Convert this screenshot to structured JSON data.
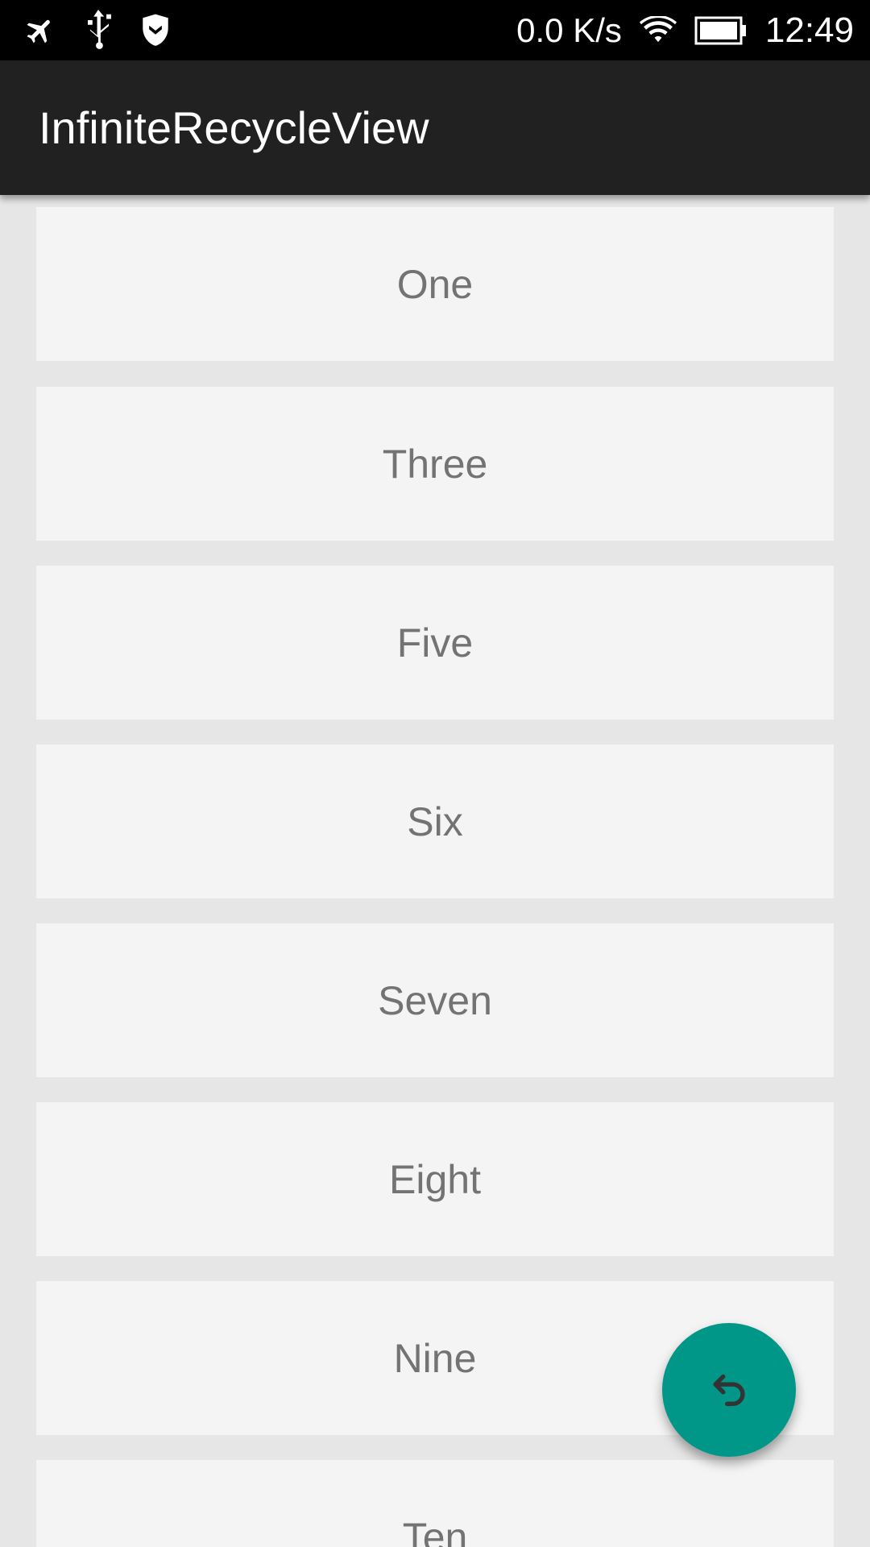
{
  "status_bar": {
    "icons": [
      "airplane-mode-icon",
      "usb-icon",
      "shield-icon"
    ],
    "network_speed": "0.0 K/s",
    "right_icons": [
      "wifi-icon",
      "battery-icon"
    ],
    "time": "12:49"
  },
  "app_bar": {
    "title": "InfiniteRecycleView"
  },
  "list": {
    "items": [
      {
        "label": "One"
      },
      {
        "label": "Three"
      },
      {
        "label": "Five"
      },
      {
        "label": "Six"
      },
      {
        "label": "Seven"
      },
      {
        "label": "Eight"
      },
      {
        "label": "Nine"
      },
      {
        "label": "Ten"
      }
    ]
  },
  "fab": {
    "icon": "undo-icon",
    "color": "#009688"
  },
  "colors": {
    "status_bar": "#000000",
    "app_bar": "#212121",
    "background": "#e6e6e6",
    "card": "#f4f4f4",
    "card_text": "#737373"
  }
}
